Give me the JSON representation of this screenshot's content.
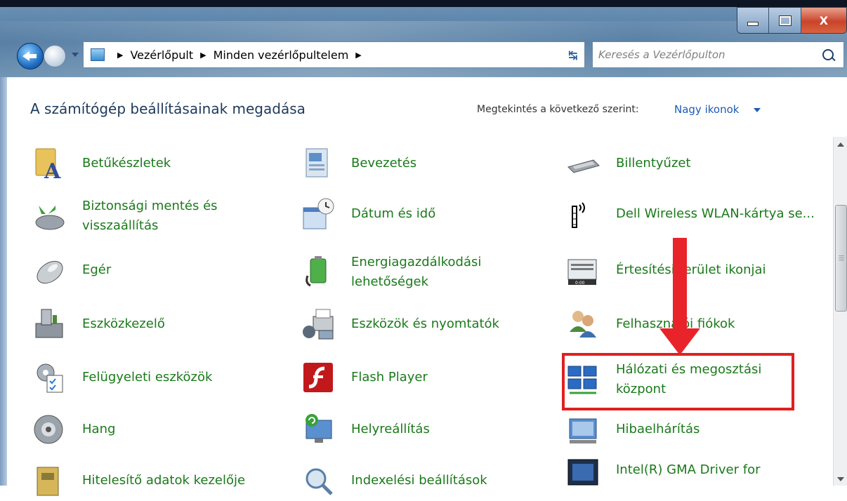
{
  "window": {
    "buttons": {
      "minimize": "–",
      "maximize": "□",
      "close": "X"
    }
  },
  "address_bar": {
    "crumbs": [
      "Vezérlőpult",
      "Minden vezérlőpultelem"
    ],
    "search_placeholder": "Keresés a Vezérlőpulton"
  },
  "header": {
    "title": "A számítógép beállításainak megadása",
    "view_by_label": "Megtekintés a következő szerint:",
    "view_by_value": "Nagy ikonok"
  },
  "items": [
    {
      "label": "Betűkészletek",
      "icon": "fonts-icon"
    },
    {
      "label": "Bevezetés",
      "icon": "getting-started-icon"
    },
    {
      "label": "Billentyűzet",
      "icon": "keyboard-icon"
    },
    {
      "label": "Biztonsági mentés és visszaállítás",
      "icon": "backup-restore-icon"
    },
    {
      "label": "Dátum és idő",
      "icon": "date-time-icon"
    },
    {
      "label": "Dell Wireless WLAN-kártya se...",
      "icon": "wireless-antenna-icon"
    },
    {
      "label": "Egér",
      "icon": "mouse-icon"
    },
    {
      "label": "Energiagazdálkodási lehetőségek",
      "icon": "power-options-icon"
    },
    {
      "label": "Értesítési terület ikonjai",
      "icon": "notification-area-icon"
    },
    {
      "label": "Eszközkezelő",
      "icon": "device-manager-icon"
    },
    {
      "label": "Eszközök és nyomtatók",
      "icon": "devices-printers-icon"
    },
    {
      "label": "Felhasználói fiókok",
      "icon": "user-accounts-icon"
    },
    {
      "label": "Felügyeleti eszközök",
      "icon": "admin-tools-icon"
    },
    {
      "label": "Flash Player",
      "icon": "flash-player-icon"
    },
    {
      "label": "Hálózati és megosztási központ",
      "icon": "network-sharing-icon"
    },
    {
      "label": "Hang",
      "icon": "speaker-icon"
    },
    {
      "label": "Helyreállítás",
      "icon": "recovery-icon"
    },
    {
      "label": "Hibaelhárítás",
      "icon": "troubleshooting-icon"
    },
    {
      "label": "Hitelesítő adatok kezelője",
      "icon": "credential-manager-icon"
    },
    {
      "label": "Indexelési beállítások",
      "icon": "indexing-icon"
    },
    {
      "label": "Intel(R) GMA Driver for",
      "icon": "intel-gma-icon"
    }
  ],
  "colors": {
    "link": "#1a7a1a",
    "annotation": "#e02020",
    "title": "#1e395b"
  }
}
